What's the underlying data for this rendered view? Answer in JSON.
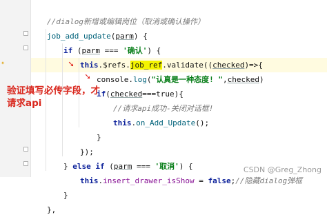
{
  "editor": {
    "lines": [
      {
        "indent": 1,
        "segments": [
          {
            "cls": "c-comment",
            "text": "//dialog新增或编辑岗位（取消或确认操作）"
          }
        ]
      },
      {
        "indent": 1,
        "segments": [
          {
            "cls": "c-fn",
            "text": "job_add_update"
          },
          {
            "cls": "",
            "text": "("
          },
          {
            "cls": "c-par",
            "text": "parm"
          },
          {
            "cls": "",
            "text": ") {"
          }
        ]
      },
      {
        "indent": 2,
        "segments": [
          {
            "cls": "c-kw",
            "text": "if"
          },
          {
            "cls": "",
            "text": " ("
          },
          {
            "cls": "c-par",
            "text": "parm"
          },
          {
            "cls": "",
            "text": " === "
          },
          {
            "cls": "c-str",
            "text": "'确认'"
          },
          {
            "cls": "",
            "text": ") {"
          }
        ]
      },
      {
        "indent": 3,
        "segments": [
          {
            "cls": "c-this",
            "text": "this"
          },
          {
            "cls": "",
            "text": ".$refs."
          },
          {
            "cls": "c-ref",
            "text": "job_ref"
          },
          {
            "cls": "",
            "text": ".validate(("
          },
          {
            "cls": "c-par",
            "text": "checked"
          },
          {
            "cls": "",
            "text": ")=>{"
          }
        ]
      },
      {
        "indent": 4,
        "segments": [
          {
            "cls": "",
            "text": "console."
          },
          {
            "cls": "c-fn",
            "text": "log"
          },
          {
            "cls": "",
            "text": "("
          },
          {
            "cls": "c-str",
            "text": "\"认真是一种态度! \""
          },
          {
            "cls": "",
            "text": ","
          },
          {
            "cls": "c-par",
            "text": "checked"
          },
          {
            "cls": "",
            "text": ")"
          }
        ]
      },
      {
        "indent": 4,
        "segments": [
          {
            "cls": "c-kw",
            "text": "if"
          },
          {
            "cls": "",
            "text": "("
          },
          {
            "cls": "c-par",
            "text": "checked"
          },
          {
            "cls": "",
            "text": "===true){"
          }
        ]
      },
      {
        "indent": 5,
        "segments": [
          {
            "cls": "c-comment",
            "text": "//请求api成功-关闭对话框!"
          }
        ]
      },
      {
        "indent": 5,
        "segments": [
          {
            "cls": "c-this",
            "text": "this"
          },
          {
            "cls": "",
            "text": "."
          },
          {
            "cls": "c-fn",
            "text": "on_Add_Update"
          },
          {
            "cls": "",
            "text": "();"
          }
        ]
      },
      {
        "indent": 4,
        "segments": [
          {
            "cls": "",
            "text": "}"
          }
        ]
      },
      {
        "indent": 3,
        "segments": [
          {
            "cls": "",
            "text": "});"
          }
        ]
      },
      {
        "indent": 2,
        "segments": [
          {
            "cls": "",
            "text": "} "
          },
          {
            "cls": "c-kw",
            "text": "else if"
          },
          {
            "cls": "",
            "text": " ("
          },
          {
            "cls": "c-par",
            "text": "parm"
          },
          {
            "cls": "",
            "text": " === "
          },
          {
            "cls": "c-str",
            "text": "'取消'"
          },
          {
            "cls": "",
            "text": ") {"
          }
        ]
      },
      {
        "indent": 3,
        "segments": [
          {
            "cls": "c-this",
            "text": "this"
          },
          {
            "cls": "",
            "text": "."
          },
          {
            "cls": "c-prop",
            "text": "insert_drawer_isShow"
          },
          {
            "cls": "",
            "text": " = "
          },
          {
            "cls": "c-kw",
            "text": "false"
          },
          {
            "cls": "",
            "text": ";"
          },
          {
            "cls": "c-comment",
            "text": "//隐藏dialog弹框"
          }
        ]
      },
      {
        "indent": 2,
        "segments": [
          {
            "cls": "",
            "text": "}"
          }
        ]
      },
      {
        "indent": 1,
        "segments": [
          {
            "cls": "",
            "text": "},"
          }
        ]
      }
    ]
  },
  "annotation": {
    "line1": "验证填写必传字段，才",
    "line2": "请求api"
  },
  "watermark": "CSDN @Greg_Zhong",
  "colors": {
    "annotation": "#d9261c",
    "ref_highlight": "#f4f400",
    "string": "#067d17",
    "keyword": "#0a1f99"
  }
}
